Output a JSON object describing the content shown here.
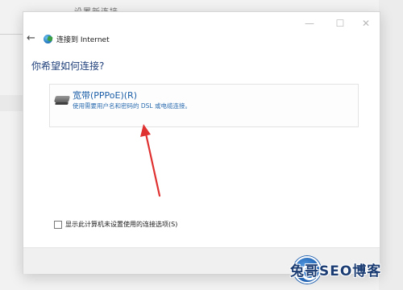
{
  "background": {
    "settings_title": "设置新连接"
  },
  "dialog": {
    "title": "连接到 Internet",
    "heading": "你希望如何连接?",
    "window_controls": {
      "minimize": "—",
      "maximize": "☐",
      "close": "✕"
    },
    "option": {
      "icon": "modem-icon",
      "title": "宽带(PPPoE)(R)",
      "description": "使用需要用户名和密码的 DSL 或电缆连接。"
    },
    "checkbox": {
      "label": "显示此计算机未设置使用的连接选项(S)",
      "checked": false
    }
  },
  "annotation": {
    "arrow_color": "#e03131"
  },
  "watermark": {
    "text": "兔哥SEO博客"
  }
}
